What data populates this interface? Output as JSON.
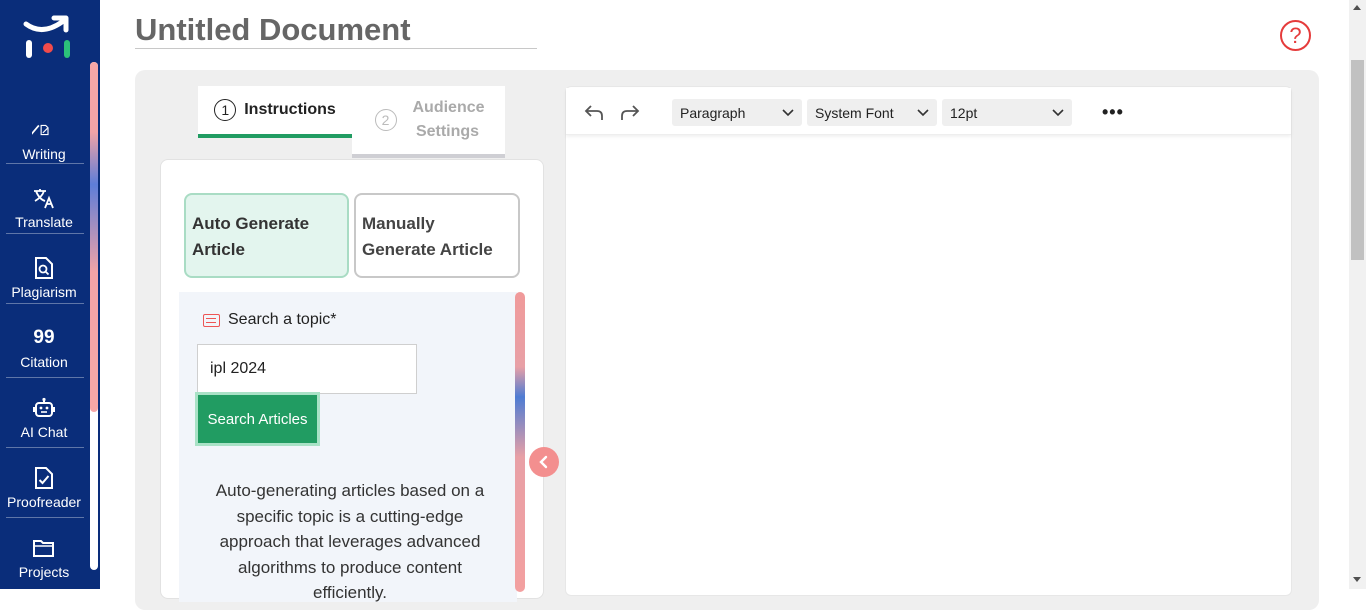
{
  "sidebar": {
    "items": [
      {
        "label": "Writing",
        "icon": "edit-check-icon"
      },
      {
        "label": "Translate",
        "icon": "translate-icon"
      },
      {
        "label": "Plagiarism",
        "icon": "plagiarism-search-icon"
      },
      {
        "label": "Citation",
        "icon": "quote-icon",
        "glyph": "99"
      },
      {
        "label": "AI Chat",
        "icon": "robot-icon"
      },
      {
        "label": "Proofreader",
        "icon": "proofread-check-icon"
      },
      {
        "label": "Projects",
        "icon": "folder-icon"
      }
    ]
  },
  "header": {
    "title": "Untitled Document",
    "help_glyph": "?"
  },
  "tabs": [
    {
      "number": "1",
      "label": "Instructions",
      "active": true
    },
    {
      "number": "2",
      "label": "Audience Settings",
      "active": false
    }
  ],
  "modes": {
    "auto_label": "Auto Generate Article",
    "manual_label": "Manually Generate Article"
  },
  "search": {
    "label": "Search a topic*",
    "value": "ipl 2024",
    "button_label": "Search Articles"
  },
  "description": "Auto-generating articles based on a specific topic is a cutting-edge approach that leverages advanced algorithms to produce content efficiently.",
  "collapse_glyph": "‹",
  "editor": {
    "format_select": "Paragraph",
    "font_select": "System Font",
    "size_select": "12pt",
    "more_glyph": "•••"
  },
  "colors": {
    "sidebar_bg": "#0a2d7a",
    "accent_green": "#219c62",
    "help_red": "#e53b3b"
  }
}
